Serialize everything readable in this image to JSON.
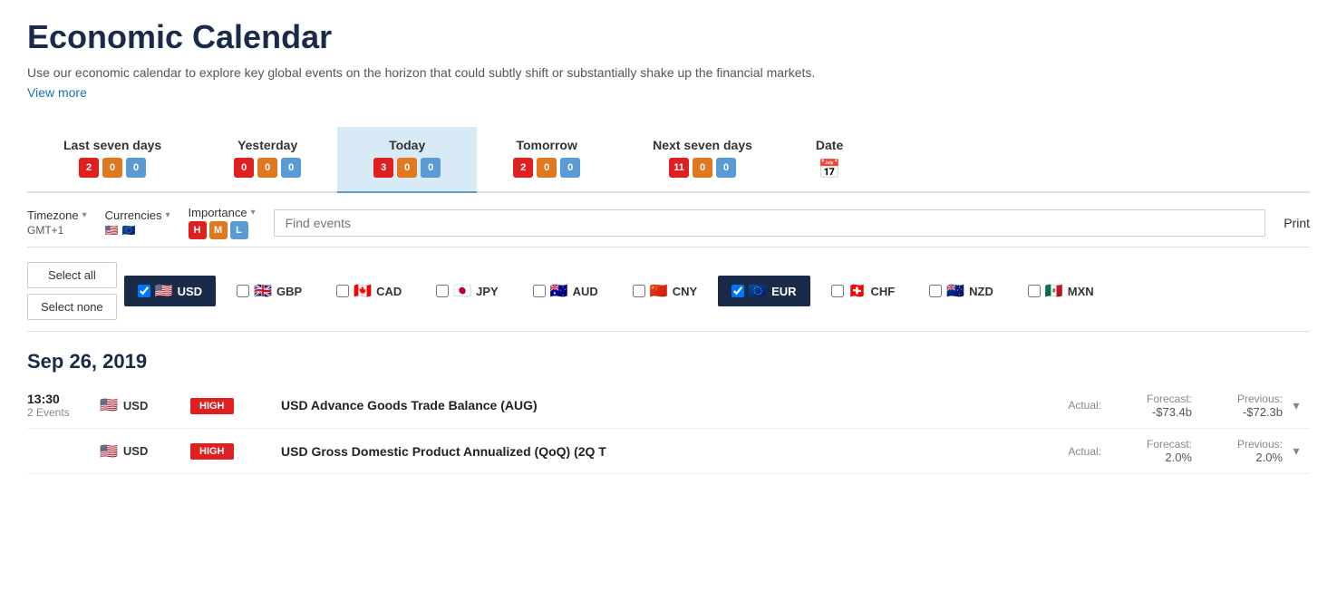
{
  "page": {
    "title": "Economic Calendar",
    "description": "Use our economic calendar to explore key global events on the horizon that could subtly shift or substantially shake up the financial markets.",
    "view_more": "View more"
  },
  "tabs": [
    {
      "id": "last7",
      "label": "Last seven days",
      "badges": [
        {
          "val": "2",
          "type": "red"
        },
        {
          "val": "0",
          "type": "orange"
        },
        {
          "val": "0",
          "type": "blue"
        }
      ],
      "active": false
    },
    {
      "id": "yesterday",
      "label": "Yesterday",
      "badges": [
        {
          "val": "0",
          "type": "red"
        },
        {
          "val": "0",
          "type": "orange"
        },
        {
          "val": "0",
          "type": "blue"
        }
      ],
      "active": false
    },
    {
      "id": "today",
      "label": "Today",
      "badges": [
        {
          "val": "3",
          "type": "red"
        },
        {
          "val": "0",
          "type": "orange"
        },
        {
          "val": "0",
          "type": "blue"
        }
      ],
      "active": true
    },
    {
      "id": "tomorrow",
      "label": "Tomorrow",
      "badges": [
        {
          "val": "2",
          "type": "red"
        },
        {
          "val": "0",
          "type": "orange"
        },
        {
          "val": "0",
          "type": "blue"
        }
      ],
      "active": false
    },
    {
      "id": "next7",
      "label": "Next seven days",
      "badges": [
        {
          "val": "11",
          "type": "red"
        },
        {
          "val": "0",
          "type": "orange"
        },
        {
          "val": "0",
          "type": "blue"
        }
      ],
      "active": false
    },
    {
      "id": "date",
      "label": "Date",
      "icon": "📅",
      "active": false
    }
  ],
  "filters": {
    "timezone_label": "Timezone",
    "timezone_val": "GMT+1",
    "currencies_label": "Currencies",
    "importance_label": "Importance",
    "importance_levels": [
      "H",
      "M",
      "L"
    ],
    "search_placeholder": "Find events",
    "print_label": "Print"
  },
  "currencies": [
    {
      "code": "USD",
      "flag": "🇺🇸",
      "selected": true
    },
    {
      "code": "GBP",
      "flag": "🇬🇧",
      "selected": false
    },
    {
      "code": "CAD",
      "flag": "🇨🇦",
      "selected": false
    },
    {
      "code": "JPY",
      "flag": "🇯🇵",
      "selected": false
    },
    {
      "code": "AUD",
      "flag": "🇦🇺",
      "selected": false
    },
    {
      "code": "CNY",
      "flag": "🇨🇳",
      "selected": false
    },
    {
      "code": "EUR",
      "flag": "🇪🇺",
      "selected": true
    },
    {
      "code": "CHF",
      "flag": "🇨🇭",
      "selected": false
    },
    {
      "code": "NZD",
      "flag": "🇳🇿",
      "selected": false
    },
    {
      "code": "MXN",
      "flag": "🇲🇽",
      "selected": false
    }
  ],
  "select_all": "Select all",
  "select_none": "Select none",
  "date_heading": "Sep 26, 2019",
  "events": [
    {
      "time": "13:30",
      "events_count": "2 Events",
      "currency": "USD",
      "currency_flag": "🇺🇸",
      "importance": "HIGH",
      "name": "USD Advance Goods Trade Balance (AUG)",
      "actual_label": "Actual:",
      "actual_val": "",
      "forecast_label": "Forecast:",
      "forecast_val": "-$73.4b",
      "prev_label": "Previous:",
      "prev_val": "-$72.3b"
    },
    {
      "time": "",
      "events_count": "",
      "currency": "USD",
      "currency_flag": "🇺🇸",
      "importance": "HIGH",
      "name": "USD Gross Domestic Product Annualized (QoQ) (2Q T",
      "actual_label": "Actual:",
      "actual_val": "",
      "forecast_label": "Forecast:",
      "forecast_val": "2.0%",
      "prev_label": "Previous:",
      "prev_val": "2.0%"
    }
  ]
}
